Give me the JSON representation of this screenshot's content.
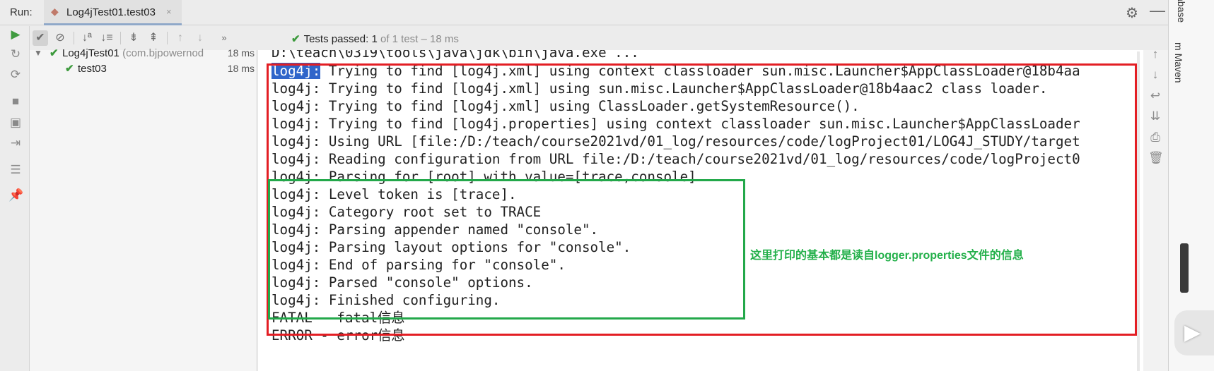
{
  "header": {
    "run_label": "Run:",
    "tab_label": "Log4jTest01.test03",
    "tab_close": "×"
  },
  "toolbar": {
    "tests_passed_label": "Tests passed:",
    "tests_passed_count": "1",
    "tests_passed_rest": "of 1 test – 18 ms"
  },
  "tree": [
    {
      "name": "Log4jTest01",
      "pkg": "(com.bjpowernod",
      "time": "18 ms"
    },
    {
      "name": "test03",
      "pkg": "",
      "time": "18 ms"
    }
  ],
  "console": {
    "cmd_line": "D:\\teach\\0319\\tools\\java\\jdk\\bin\\java.exe ...",
    "selected_prefix": "log4j:",
    "lines": [
      " Trying to find [log4j.xml] using context classloader sun.misc.Launcher$AppClassLoader@18b4aa",
      "log4j: Trying to find [log4j.xml] using sun.misc.Launcher$AppClassLoader@18b4aac2 class loader.",
      "log4j: Trying to find [log4j.xml] using ClassLoader.getSystemResource().",
      "log4j: Trying to find [log4j.properties] using context classloader sun.misc.Launcher$AppClassLoader",
      "log4j: Using URL [file:/D:/teach/course2021vd/01_log/resources/code/logProject01/LOG4J_STUDY/target",
      "log4j: Reading configuration from URL file:/D:/teach/course2021vd/01_log/resources/code/logProject0",
      "log4j: Parsing for [root] with value=[trace,console].",
      "log4j: Level token is [trace].",
      "log4j: Category root set to TRACE",
      "log4j: Parsing appender named \"console\".",
      "log4j: Parsing layout options for \"console\".",
      "log4j: End of parsing for \"console\".",
      "log4j: Parsed \"console\" options.",
      "log4j: Finished configuring.",
      "FATAL - fatal信息",
      "ERROR - error信息"
    ],
    "annotation": "这里打印的基本都是读自logger.properties文件的信息"
  },
  "side": {
    "database_label": "abase",
    "maven_label": "Maven"
  },
  "icons": {
    "settings": "gear-icon",
    "minimize": "minimize-icon",
    "run": "run-icon",
    "rerun": "rerun-icon",
    "stop": "stop-icon",
    "camera": "snapshot-icon",
    "export": "export-icon",
    "layout": "layout-icon",
    "pin": "pin-icon",
    "play": "play-icon"
  },
  "colors": {
    "red_box": "#e31e24",
    "green_box": "#23a84a",
    "annotation": "#23b04a",
    "selection": "#2f65ca",
    "passed_check": "#3d9a3d"
  }
}
